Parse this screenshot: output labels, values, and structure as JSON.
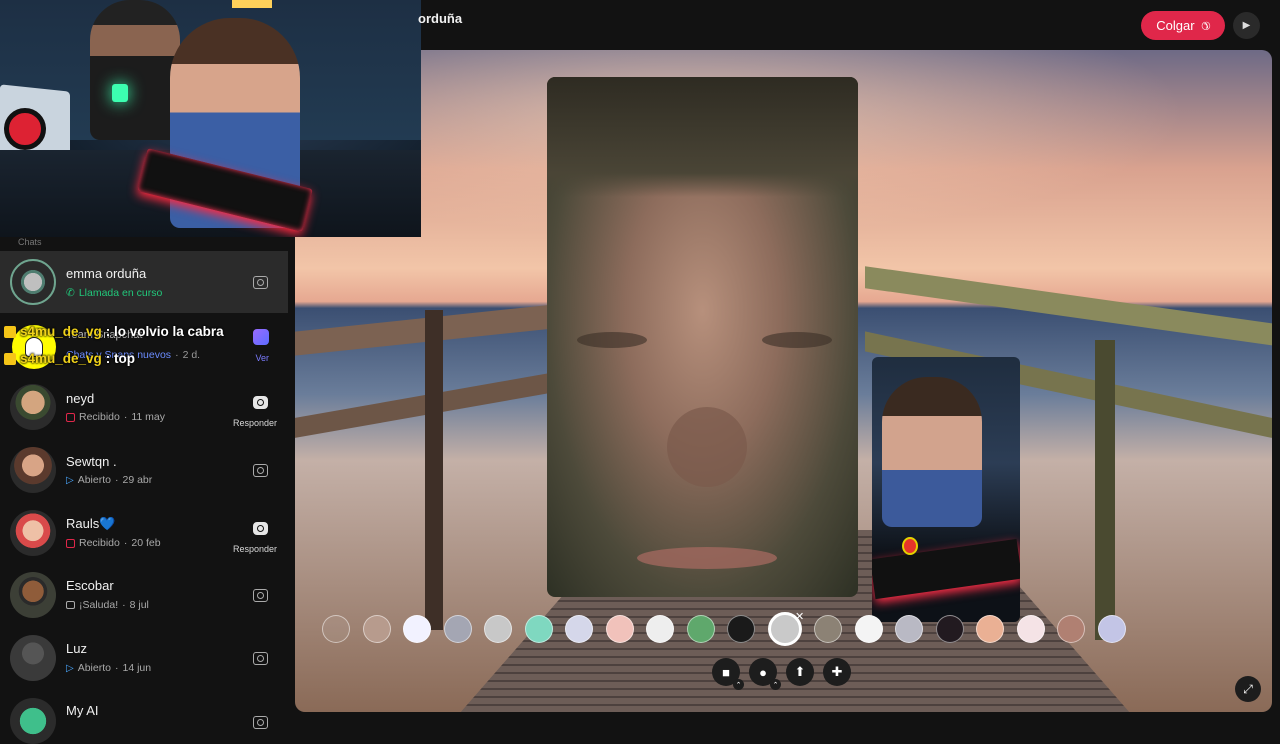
{
  "call": {
    "title": "orduña",
    "hangup_label": "Colgar",
    "colors": {
      "hangup": "#e0274a",
      "accent_green": "#21c77a",
      "overlay_user": "#f0d21a"
    }
  },
  "sidebar": {
    "section_label": "Chats",
    "chats": [
      {
        "name": "emma orduña",
        "status": "Llamada en curso",
        "status_icon": "phone-icon",
        "action": "camera"
      },
      {
        "name": "Team Snapchat",
        "status": "Chats y Snaps nuevos",
        "time": "2 d.",
        "action_label": "Ver"
      },
      {
        "name": "neyd",
        "status": "Recibido",
        "time": "11 may",
        "action_label": "Responder"
      },
      {
        "name": "Sewtqn .",
        "status": "Abierto",
        "time": "29 abr"
      },
      {
        "name": "Rauls💙",
        "status": "Recibido",
        "time": "20 feb",
        "action_label": "Responder"
      },
      {
        "name": "Escobar",
        "status": "¡Saluda!",
        "time": "8 jul"
      },
      {
        "name": "Luz",
        "status": "Abierto",
        "time": "14 jun"
      },
      {
        "name": "My AI"
      }
    ]
  },
  "overlay_chat": [
    {
      "user": "s4mu_de_vg",
      "message": ": lo volvio la cabra"
    },
    {
      "user": "s4mu_de_vg",
      "message": ": top"
    }
  ],
  "controls": {
    "video_icon": "video-camera-icon",
    "mic_icon": "microphone-icon",
    "share_icon": "screen-share-icon",
    "add_icon": "add-person-icon",
    "expand_icon": "expand-icon"
  }
}
